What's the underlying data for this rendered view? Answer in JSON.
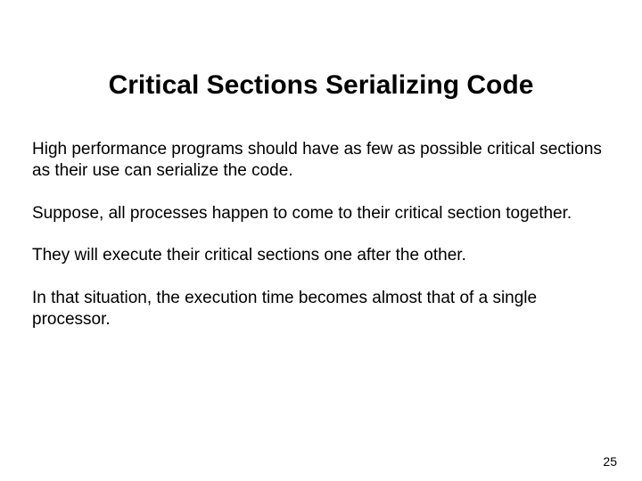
{
  "slide": {
    "title": "Critical Sections Serializing Code",
    "paragraphs": [
      "High performance programs should have as few as possible critical sections as their use can serialize the code.",
      "Suppose, all processes happen to come to their critical section together.",
      "They will execute their critical sections one after the other.",
      "In that situation, the execution time becomes almost that of a single processor."
    ],
    "page_number": "25"
  }
}
